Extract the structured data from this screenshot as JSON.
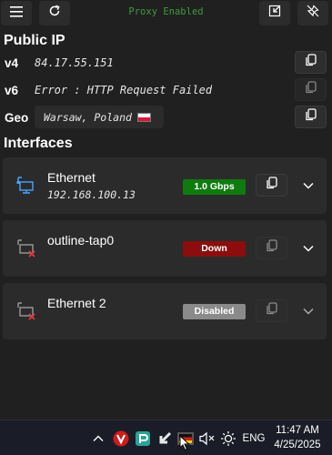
{
  "topbar": {
    "menu_icon": "hamburger-menu-icon",
    "refresh_icon": "refresh-icon",
    "proxy_status": "Proxy Enabled",
    "proxy_color": "#3e9a3e",
    "minimize_icon": "collapse-window-icon",
    "unpin_icon": "unpin-icon"
  },
  "public_ip": {
    "title": "Public IP",
    "v4": {
      "label": "v4",
      "value": "84.17.55.151"
    },
    "v6": {
      "label": "v6",
      "value": "Error : HTTP Request Failed"
    },
    "geo": {
      "label": "Geo",
      "value": "Warsaw, Poland",
      "flag": "poland-flag-icon"
    }
  },
  "interfaces": {
    "title": "Interfaces",
    "items": [
      {
        "name": "Ethernet",
        "address": "192.168.100.13",
        "status": "1.0 Gbps",
        "status_color": "#0f7b0f",
        "icon": "network-connected-icon"
      },
      {
        "name": "outline-tap0",
        "address": "",
        "status": "Down",
        "status_color": "#8b0d0d",
        "icon": "network-disconnected-icon"
      },
      {
        "name": "Ethernet 2",
        "address": "",
        "status": "Disabled",
        "status_color": "#8a8a8a",
        "icon": "network-disconnected-icon"
      }
    ]
  },
  "taskbar": {
    "language": "ENG",
    "time": "11:47 AM",
    "date": "4/25/2025",
    "icons": [
      "show-hidden-icons-chevron",
      "vivaldi-icon",
      "app-tray-icon",
      "arrow-tray-icon",
      "flag-tray-icon",
      "volume-muted-icon",
      "brightness-icon"
    ]
  }
}
